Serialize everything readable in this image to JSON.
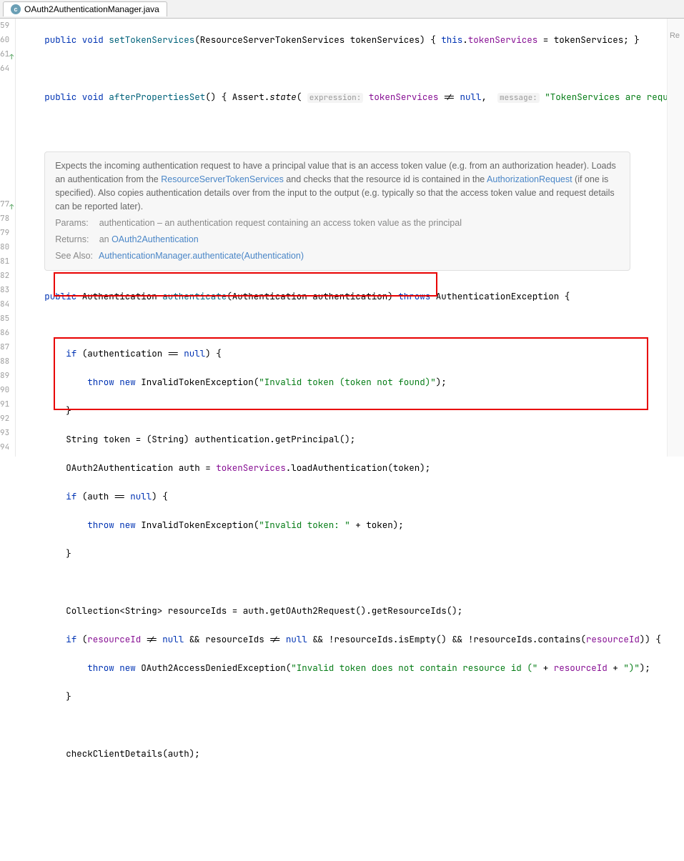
{
  "tab": {
    "filename": "OAuth2AuthenticationManager.java"
  },
  "reader": "Re",
  "gutter": [
    "59",
    "60",
    "61",
    "64",
    "",
    "",
    "",
    "",
    "",
    "",
    "",
    "",
    "",
    "77",
    "78",
    "79",
    "80",
    "81",
    "82",
    "83",
    "84",
    "85",
    "86",
    "87",
    "88",
    "89",
    "90",
    "91",
    "92",
    "93",
    "94"
  ],
  "gutter_markers": {
    "2": "↑",
    "13": "↑"
  },
  "line59": {
    "p1": "public void ",
    "m": "setTokenServices",
    "p2": "(ResourceServerTokenServices tokenServices) { ",
    "kw": "this",
    "p3": ".",
    "f": "tokenServices",
    "p4": " = tokenServices; }"
  },
  "line61": {
    "p1": "public void ",
    "m": "afterPropertiesSet",
    "p2": "() { Assert.",
    "c": "state",
    "p3": "( ",
    "h1": "expression:",
    "sp1": " ",
    "f": "tokenServices",
    "p4": " != ",
    "kw": "null",
    "p5": ",  ",
    "h2": "message:",
    "sp2": " ",
    "s": "\"TokenServices are required\"",
    "p6": ");"
  },
  "doc": {
    "d1": "Expects the incoming authentication request to have a principal value that is an access token value (e.g. from an authorization header). Loads an authentication from the ",
    "l1": "ResourceServerTokenServices",
    "d2": " and checks that the resource id is contained in the ",
    "l2": "AuthorizationRequest",
    "d3": " (if one is specified). Also copies authentication details over from the input to the output (e.g. typically so that the access token value and request details can be reported later).",
    "params_label": "Params:",
    "params": "authentication – an authentication request containing an access token value as the principal",
    "returns_label": "Returns:",
    "returns_pre": "an ",
    "returns_link": "OAuth2Authentication",
    "see_label": "See Also:",
    "see_link": "AuthenticationManager.authenticate(Authentication)"
  },
  "line77": {
    "p1": "public ",
    "t": "Authentication ",
    "m": "authenticate",
    "p2": "(Authentication authentication) ",
    "kw": "throws",
    "p3": " AuthenticationException {"
  },
  "line79": {
    "p1": "    ",
    "kw": "if",
    "p2": " (authentication == ",
    "kw2": "null",
    "p3": ") {"
  },
  "line80": {
    "p1": "        ",
    "kw": "throw new",
    "p2": " InvalidTokenException(",
    "s": "\"Invalid token (token not found)\"",
    "p3": ");"
  },
  "line81": "    }",
  "line82": "    String token = (String) authentication.getPrincipal();",
  "line83": {
    "p1": "    OAuth2Authentication auth = ",
    "f": "tokenServices",
    "p2": ".loadAuthentication(token);"
  },
  "line84": {
    "p1": "    ",
    "kw": "if",
    "p2": " (auth == ",
    "kw2": "null",
    "p3": ") {"
  },
  "line85": {
    "p1": "        ",
    "kw": "throw new",
    "p2": " InvalidTokenException(",
    "s": "\"Invalid token: \"",
    "p3": " + token);"
  },
  "line86": "    }",
  "line88": "    Collection<String> resourceIds = auth.getOAuth2Request().getResourceIds();",
  "line89": {
    "p1": "    ",
    "kw": "if",
    "p2": " (",
    "f": "resourceId",
    "p3": " != ",
    "kw2": "null",
    "p4": " && resourceIds != ",
    "kw3": "null",
    "p5": " && !resourceIds.isEmpty() && !resourceIds.contains(",
    "f2": "resourceId",
    "p6": ")) {"
  },
  "line90": {
    "p1": "        ",
    "kw": "throw new",
    "p2": " OAuth2AccessDeniedException(",
    "s": "\"Invalid token does not contain resource id (\"",
    "p3": " + ",
    "f": "resourceId",
    "p4": " + ",
    "s2": "\")\"",
    "p5": ");"
  },
  "line91": "    }",
  "line93": "    checkClientDetails(auth);"
}
